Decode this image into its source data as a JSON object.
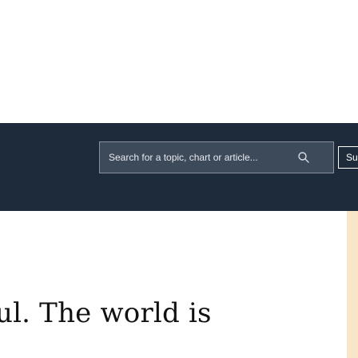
{
  "header": {
    "search": {
      "placeholder": "Search for a topic, chart or article..."
    },
    "subscribe_label": "Sub"
  },
  "article": {
    "headline_fragment": "ul. The world is"
  },
  "colors": {
    "header_background": "#1d2b3a",
    "search_background": "#3d4a5a",
    "accent_strip": "#f7e6c8"
  },
  "icons": {
    "search": "search-icon"
  }
}
